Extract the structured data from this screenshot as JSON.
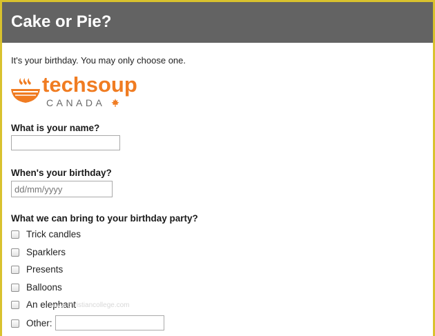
{
  "header": {
    "title": "Cake or Pie?"
  },
  "intro": {
    "text": "It's your birthday. You may only choose one."
  },
  "logo": {
    "word": "techsoup",
    "sub": "CANADA",
    "colors": {
      "primary": "#f07c22",
      "secondary": "#6a6a6a"
    }
  },
  "form": {
    "name_question": "What is your name?",
    "name_value": "",
    "birthday_question": "When's your birthday?",
    "birthday_placeholder": "dd/mm/yyyy",
    "party_question": "What we can bring to your birthday party?",
    "options": [
      {
        "label": "Trick candles",
        "checked": false
      },
      {
        "label": "Sparklers",
        "checked": false
      },
      {
        "label": "Presents",
        "checked": false
      },
      {
        "label": "Balloons",
        "checked": false
      },
      {
        "label": "An elephant",
        "checked": false
      },
      {
        "label": "Other:",
        "checked": false
      }
    ],
    "other_value": ""
  },
  "watermark": {
    "text": "www.christiancollege.com"
  },
  "colors": {
    "header_bg": "#636363",
    "frame_border": "#d9c22e"
  }
}
